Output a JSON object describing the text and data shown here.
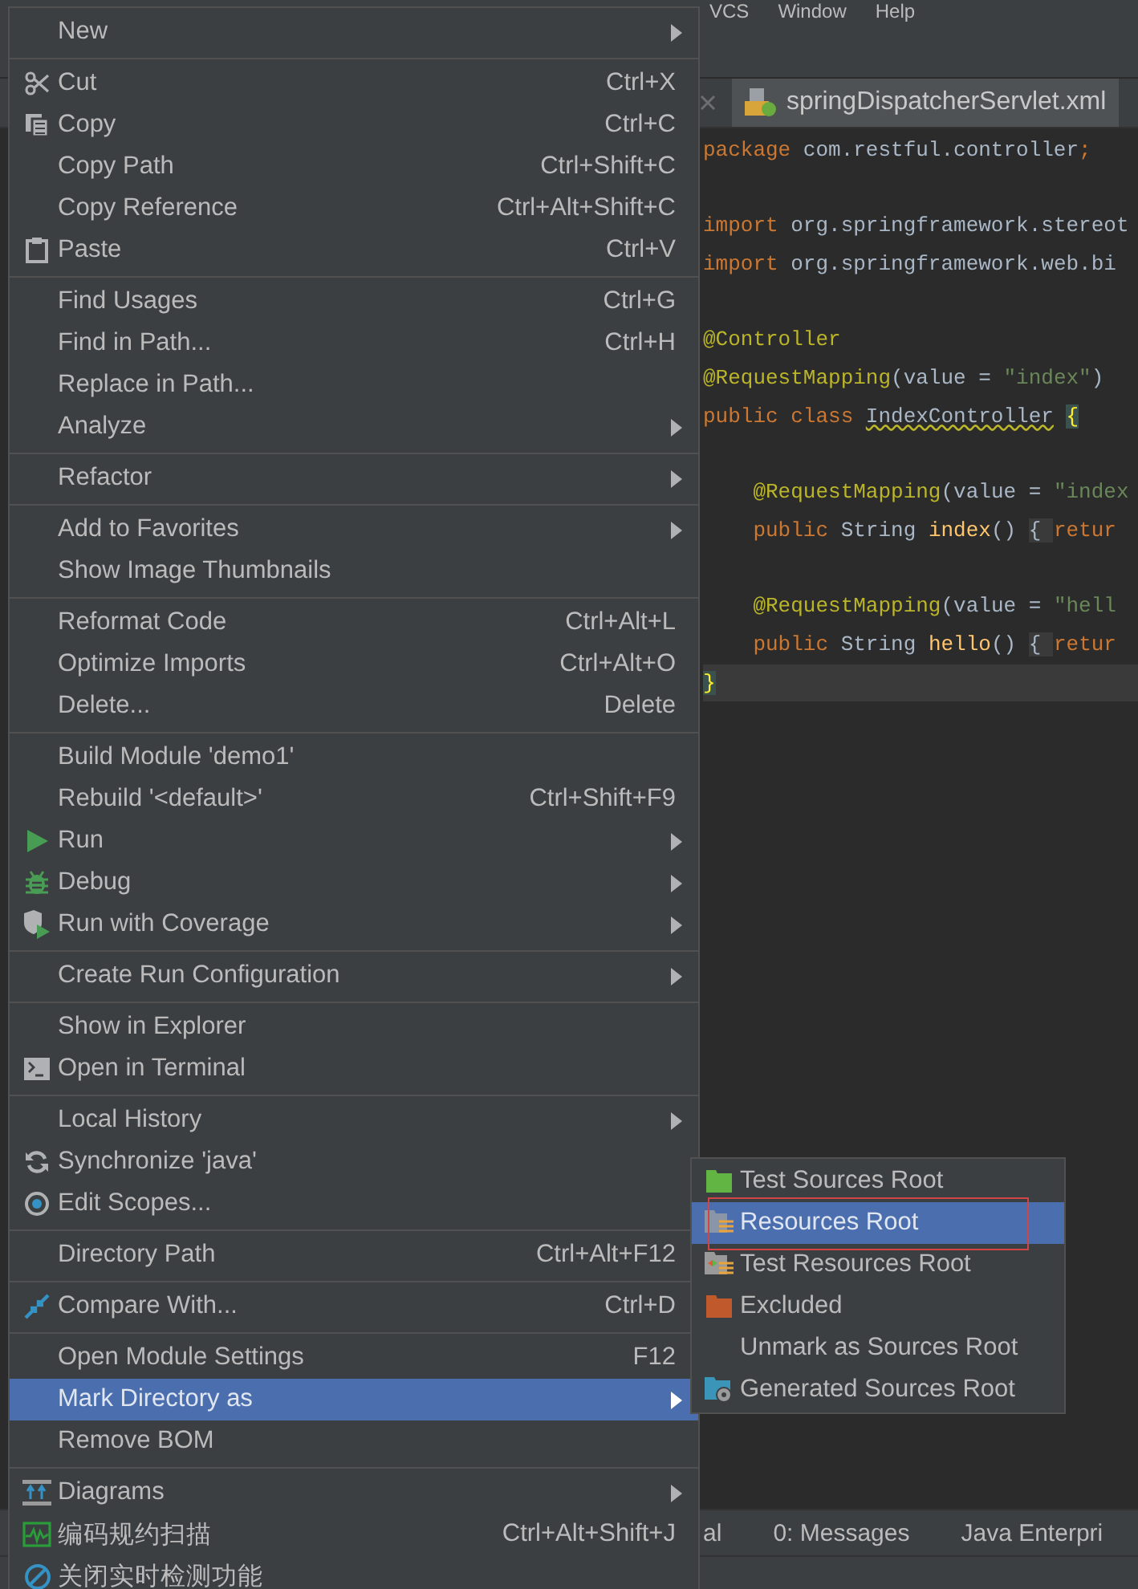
{
  "menu_bar": [
    "VCS",
    "Window",
    "Help"
  ],
  "editor_tab": {
    "title": "springDispatcherServlet.xml",
    "selected": true
  },
  "code_lines": [
    {
      "current": false,
      "tokens": [
        {
          "kind": "kw",
          "text": "package"
        },
        {
          "kind": "plain",
          "text": " com.restful.controller"
        },
        {
          "kind": "kw",
          "text": ";"
        }
      ]
    },
    {
      "current": false
    },
    {
      "current": false,
      "tokens": [
        {
          "kind": "kw",
          "text": "import"
        },
        {
          "kind": "plain",
          "text": " org.springframework.stereot"
        }
      ]
    },
    {
      "current": false,
      "tokens": [
        {
          "kind": "kw",
          "text": "import"
        },
        {
          "kind": "plain",
          "text": " org.springframework.web.bi"
        }
      ]
    },
    {
      "current": false
    },
    {
      "current": false,
      "tokens": [
        {
          "kind": "anno",
          "text": "@Controller"
        }
      ]
    },
    {
      "current": false,
      "tokens": [
        {
          "kind": "anno",
          "text": "@RequestMapping"
        },
        {
          "kind": "plain",
          "text": "(value = "
        },
        {
          "kind": "str",
          "text": "\"index\""
        },
        {
          "kind": "plain",
          "text": ")"
        }
      ]
    },
    {
      "current": false,
      "tokens": [
        {
          "kind": "kw",
          "text": "public class "
        },
        {
          "kind": "warn",
          "text": "IndexController"
        },
        {
          "kind": "brace",
          "text": "{"
        }
      ]
    },
    {
      "current": false
    },
    {
      "current": false,
      "tokens": [
        {
          "kind": "anno",
          "text": "    @RequestMapping"
        },
        {
          "kind": "plain",
          "text": "(value = "
        },
        {
          "kind": "str",
          "text": "\"index"
        }
      ]
    },
    {
      "current": false,
      "tokens": [
        {
          "kind": "kw",
          "text": "    public "
        },
        {
          "kind": "plain",
          "text": "String "
        },
        {
          "kind": "method",
          "text": "index"
        },
        {
          "kind": "plain",
          "text": "() "
        },
        {
          "kind": "fold",
          "text": "{ "
        },
        {
          "kind": "kw",
          "text": "retur"
        }
      ]
    },
    {
      "current": false
    },
    {
      "current": false,
      "tokens": [
        {
          "kind": "anno",
          "text": "    @RequestMapping"
        },
        {
          "kind": "plain",
          "text": "(value = "
        },
        {
          "kind": "str",
          "text": "\"hell"
        }
      ]
    },
    {
      "current": false,
      "tokens": [
        {
          "kind": "kw",
          "text": "    public "
        },
        {
          "kind": "plain",
          "text": "String "
        },
        {
          "kind": "method",
          "text": "hello"
        },
        {
          "kind": "plain",
          "text": "() "
        },
        {
          "kind": "fold",
          "text": "{ "
        },
        {
          "kind": "kw",
          "text": "retur"
        }
      ]
    },
    {
      "current": true,
      "tokens": [
        {
          "kind": "brace",
          "text": "}"
        }
      ]
    }
  ],
  "tool_tabs": [
    {
      "label": "al"
    },
    {
      "label": "0: Messages"
    },
    {
      "label": "Java Enterpri"
    }
  ],
  "context_menu": {
    "sections": [
      {
        "items": [
          {
            "label": "New",
            "submenu": true,
            "selected": false
          }
        ]
      },
      {
        "items": [
          {
            "label": "Cut",
            "shortcut": "Ctrl+X",
            "submenu": false,
            "selected": false
          },
          {
            "label": "Copy",
            "shortcut": "Ctrl+C",
            "submenu": false,
            "selected": false
          },
          {
            "label": "Copy Path",
            "shortcut": "Ctrl+Shift+C",
            "submenu": false,
            "selected": false
          },
          {
            "label": "Copy Reference",
            "shortcut": "Ctrl+Alt+Shift+C",
            "submenu": false,
            "selected": false
          },
          {
            "label": "Paste",
            "shortcut": "Ctrl+V",
            "submenu": false,
            "selected": false
          }
        ]
      },
      {
        "items": [
          {
            "label": "Find Usages",
            "shortcut": "Ctrl+G",
            "submenu": false,
            "selected": false
          },
          {
            "label": "Find in Path...",
            "shortcut": "Ctrl+H",
            "submenu": false,
            "selected": false
          },
          {
            "label": "Replace in Path...",
            "submenu": false,
            "selected": false
          },
          {
            "label": "Analyze",
            "submenu": true,
            "selected": false
          }
        ]
      },
      {
        "items": [
          {
            "label": "Refactor",
            "submenu": true,
            "selected": false
          }
        ]
      },
      {
        "items": [
          {
            "label": "Add to Favorites",
            "submenu": true,
            "selected": false
          },
          {
            "label": "Show Image Thumbnails",
            "submenu": false,
            "selected": false
          }
        ]
      },
      {
        "items": [
          {
            "label": "Reformat Code",
            "shortcut": "Ctrl+Alt+L",
            "submenu": false,
            "selected": false
          },
          {
            "label": "Optimize Imports",
            "shortcut": "Ctrl+Alt+O",
            "submenu": false,
            "selected": false
          },
          {
            "label": "Delete...",
            "shortcut": "Delete",
            "submenu": false,
            "selected": false
          }
        ]
      },
      {
        "items": [
          {
            "label": "Build Module 'demo1'",
            "submenu": false,
            "selected": false
          },
          {
            "label": "Rebuild '<default>'",
            "shortcut": "Ctrl+Shift+F9",
            "submenu": false,
            "selected": false
          },
          {
            "label": "Run",
            "submenu": true,
            "selected": false
          },
          {
            "label": "Debug",
            "submenu": true,
            "selected": false
          },
          {
            "label": "Run with Coverage",
            "submenu": true,
            "selected": false
          }
        ]
      },
      {
        "items": [
          {
            "label": "Create Run Configuration",
            "submenu": true,
            "selected": false
          }
        ]
      },
      {
        "items": [
          {
            "label": "Show in Explorer",
            "submenu": false,
            "selected": false
          },
          {
            "label": "Open in Terminal",
            "submenu": false,
            "selected": false
          }
        ]
      },
      {
        "items": [
          {
            "label": "Local History",
            "submenu": true,
            "selected": false
          },
          {
            "label": "Synchronize 'java'",
            "submenu": false,
            "selected": false
          },
          {
            "label": "Edit Scopes...",
            "submenu": false,
            "selected": false
          }
        ]
      },
      {
        "items": [
          {
            "label": "Directory Path",
            "shortcut": "Ctrl+Alt+F12",
            "submenu": false,
            "selected": false
          }
        ]
      },
      {
        "items": [
          {
            "label": "Compare With...",
            "shortcut": "Ctrl+D",
            "submenu": false,
            "selected": false
          }
        ]
      },
      {
        "items": [
          {
            "label": "Open Module Settings",
            "shortcut": "F12",
            "submenu": false,
            "selected": false
          },
          {
            "label": "Mark Directory as",
            "submenu": true,
            "selected": true
          },
          {
            "label": "Remove BOM",
            "submenu": false,
            "selected": false
          }
        ]
      },
      {
        "items": [
          {
            "label": "Diagrams",
            "submenu": true,
            "selected": false
          },
          {
            "label": "编码规约扫描",
            "shortcut": "Ctrl+Alt+Shift+J",
            "submenu": false,
            "selected": false
          },
          {
            "label": "关闭实时检测功能",
            "submenu": false,
            "selected": false
          }
        ]
      }
    ]
  },
  "submenu": {
    "items": [
      {
        "label": "Test Sources Root",
        "selected": false
      },
      {
        "label": "Resources Root",
        "selected": true,
        "outlined": true
      },
      {
        "label": "Test Resources Root",
        "selected": false
      },
      {
        "label": "Excluded",
        "selected": false
      },
      {
        "label": "Unmark as Sources Root",
        "selected": false
      },
      {
        "label": "Generated Sources Root",
        "selected": false
      }
    ]
  }
}
